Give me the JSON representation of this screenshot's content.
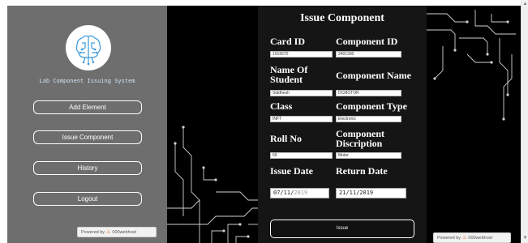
{
  "sidebar": {
    "system_title": "Lab Component Issuing System",
    "buttons": {
      "add": "Add Element",
      "issue": "Issue Component",
      "history": "History",
      "logout": "Logout"
    },
    "powered_by": "Powered by",
    "host_brand": "000webhost"
  },
  "form": {
    "title": "Issue Component",
    "card_id_label": "Card ID",
    "card_id_value": "1916670",
    "component_id_label": "Component ID",
    "component_id_value": "2401300",
    "student_name_label": "Name Of Student",
    "student_name_value": "Siddhesh",
    "component_name_label": "Component Name",
    "component_name_value": "DCMOTOR",
    "class_label": "Class",
    "class_value": "INFT",
    "component_type_label": "Component Type",
    "component_type_value": "Electronic",
    "roll_no_label": "Roll No",
    "roll_no_value": "69",
    "component_description_label": "Component Discription",
    "component_description_value": "Motor",
    "issue_date_label": "Issue Date",
    "issue_date_day_month": "07/11/",
    "issue_date_year": "2019",
    "return_date_label": "Return Date",
    "return_date_value": "21/11/2019",
    "issue_button": "Issue"
  },
  "icons": {
    "logo": "brain-circuit-icon",
    "host_logo": "fire-icon"
  },
  "colors": {
    "sidebar_bg": "#6e6e6e",
    "main_bg": "#000000",
    "panel_bg": "#151515",
    "title_blue": "#cfe3f5"
  }
}
